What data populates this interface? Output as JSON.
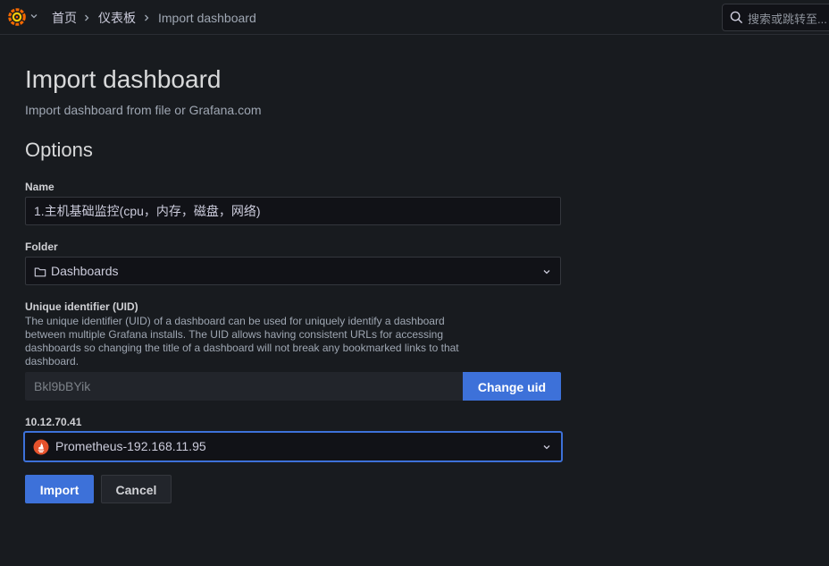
{
  "header": {
    "breadcrumbs": [
      "首页",
      "仪表板",
      "Import dashboard"
    ],
    "search_placeholder": "搜索或跳转至..."
  },
  "page": {
    "title": "Import dashboard",
    "subtitle": "Import dashboard from file or Grafana.com",
    "section_title": "Options"
  },
  "form": {
    "name_label": "Name",
    "name_value": "1.主机基础监控(cpu，内存，磁盘，网络)",
    "folder_label": "Folder",
    "folder_value": "Dashboards",
    "uid_label": "Unique identifier (UID)",
    "uid_description": "The unique identifier (UID) of a dashboard can be used for uniquely identify a dashboard between multiple Grafana installs. The UID allows having consistent URLs for accessing dashboards so changing the title of a dashboard will not break any bookmarked links to that dashboard.",
    "uid_value": "Bkl9bBYik",
    "change_uid_label": "Change uid",
    "datasource_label": "10.12.70.41",
    "datasource_value": "Prometheus-192.168.11.95",
    "import_label": "Import",
    "cancel_label": "Cancel"
  },
  "colors": {
    "background": "#181b1f",
    "primary": "#3d71d9",
    "grafana_orange": "#f46800",
    "prometheus_red": "#e6522c"
  },
  "icons": {
    "logo": "grafana-logo-icon",
    "search": "search-icon",
    "folder": "folder-icon",
    "datasource": "prometheus-icon",
    "dropdown": "chevron-down-icon"
  }
}
